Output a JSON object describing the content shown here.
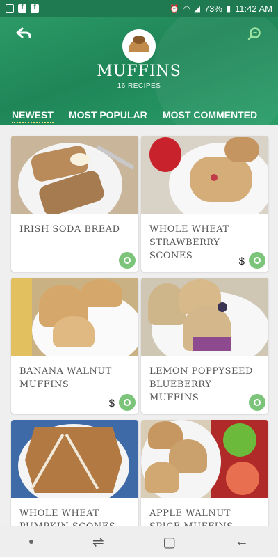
{
  "status_bar": {
    "battery": "73%",
    "time": "11:42 AM"
  },
  "header": {
    "title": "MUFFINS",
    "recipe_count": "16 RECIPES"
  },
  "tabs": [
    {
      "label": "NEWEST",
      "active": true
    },
    {
      "label": "MOST POPULAR",
      "active": false
    },
    {
      "label": "MOST COMMENTED",
      "active": false
    }
  ],
  "recipes": [
    {
      "name": "IRISH SODA BREAD",
      "has_price": false
    },
    {
      "name": "WHOLE WHEAT STRAWBERRY SCONES",
      "has_price": true
    },
    {
      "name": "BANANA WALNUT MUFFINS",
      "has_price": true
    },
    {
      "name": "LEMON POPPYSEED BLUEBERRY MUFFINS",
      "has_price": false
    },
    {
      "name": "WHOLE WHEAT PUMPKIN SCONES",
      "has_price": false
    },
    {
      "name": "APPLE WALNUT SPICE MUFFINS",
      "has_price": false
    }
  ],
  "colors": {
    "header_green": "#1f8658",
    "badge_green": "#7bc47a",
    "tab_underline": "#ffe27a"
  },
  "icons": {
    "back": "back-arrow-icon",
    "search": "search-icon",
    "badge": "veggie-leaf-icon",
    "price": "money-hand-icon"
  }
}
